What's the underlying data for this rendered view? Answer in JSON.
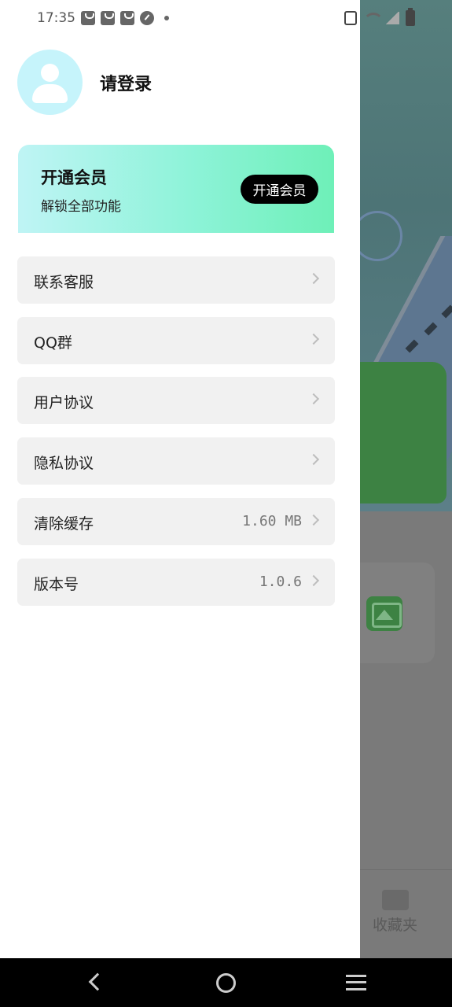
{
  "status_bar": {
    "time": "17:35"
  },
  "profile": {
    "login_text": "请登录"
  },
  "vip": {
    "title": "开通会员",
    "subtitle": "解锁全部功能",
    "button_label": "开通会员"
  },
  "menu": [
    {
      "label": "联系客服",
      "value": ""
    },
    {
      "label": "QQ群",
      "value": ""
    },
    {
      "label": "用户协议",
      "value": ""
    },
    {
      "label": "隐私协议",
      "value": ""
    },
    {
      "label": "清除缓存",
      "value": "1.60 MB"
    },
    {
      "label": "版本号",
      "value": "1.0.6"
    }
  ],
  "background_app": {
    "tab_label": "收藏夹"
  },
  "colors": {
    "vip_gradient_start": "#bff4f5",
    "vip_gradient_end": "#6ef0b8",
    "avatar_bg": "#c6f4fb",
    "menu_item_bg": "#f1f1f1",
    "vip_button_bg": "#000000"
  },
  "icons": {
    "avatar": "user-avatar-icon",
    "chevron": "chevron-right-icon",
    "tab": "folder-icon"
  }
}
